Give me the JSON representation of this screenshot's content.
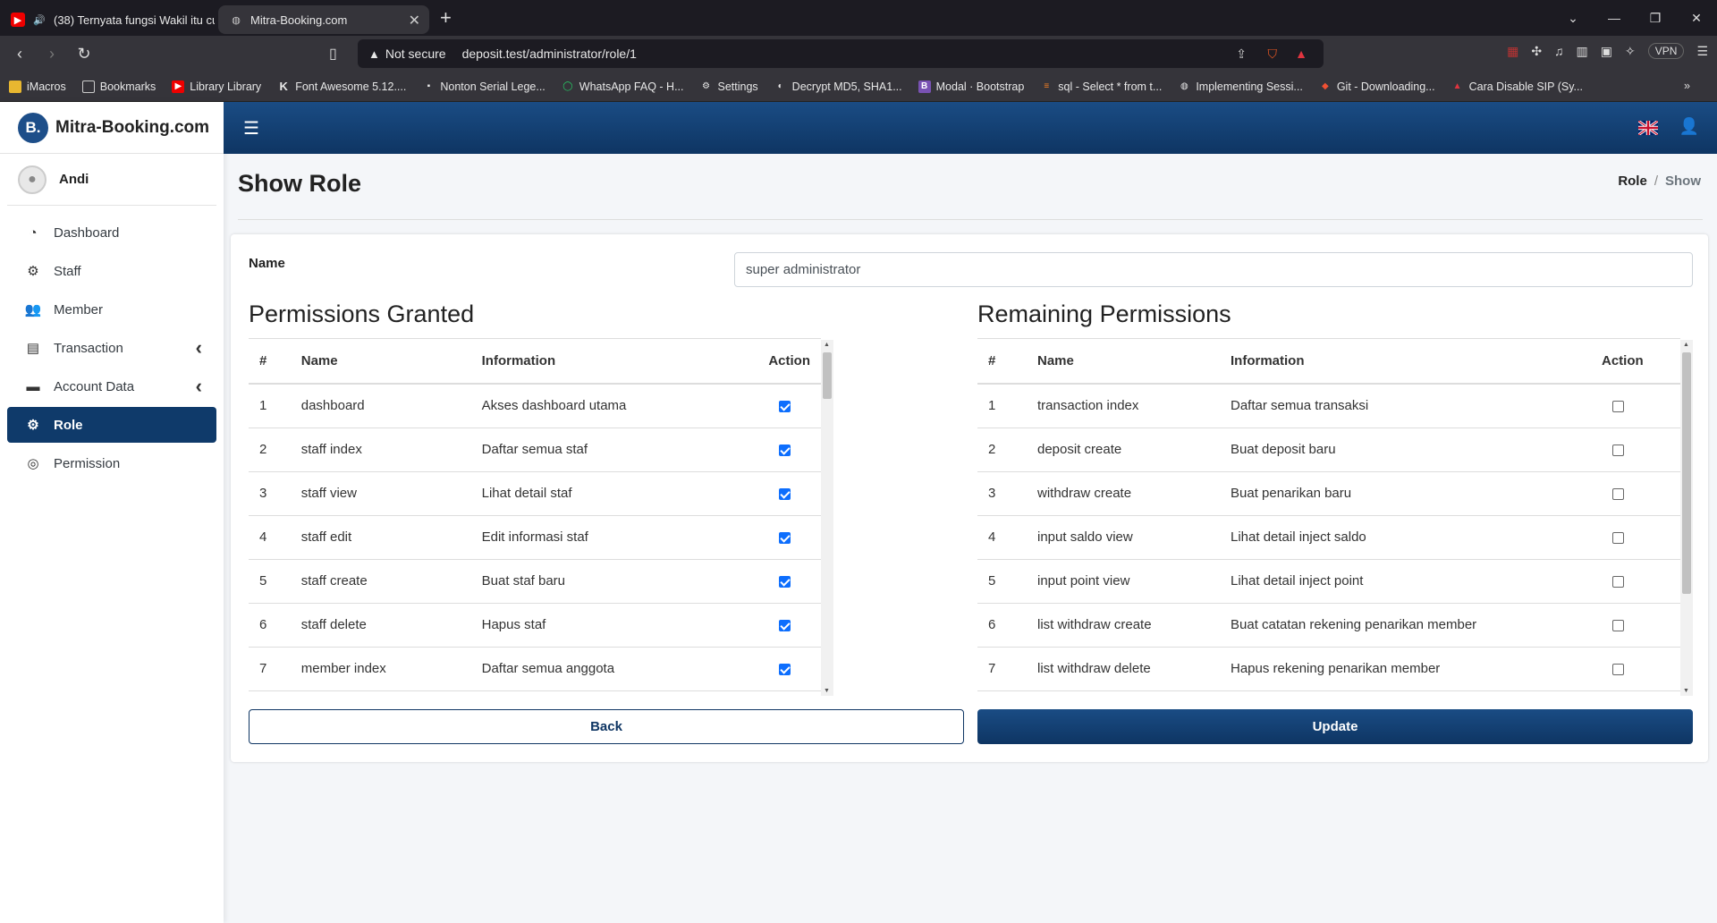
{
  "browser": {
    "tabs": [
      {
        "title": "(38) Ternyata fungsi Wakil itu cu",
        "active": false
      },
      {
        "title": "Mitra-Booking.com",
        "active": true
      }
    ],
    "security_label": "Not secure",
    "url": "deposit.test/administrator/role/1",
    "vpn_label": "VPN",
    "bookmarks": [
      "iMacros",
      "Bookmarks",
      "Library Library",
      "Font Awesome 5.12....",
      "Nonton Serial Lege...",
      "WhatsApp FAQ - H...",
      "Settings",
      "Decrypt MD5, SHA1...",
      "Modal · Bootstrap",
      "sql - Select * from t...",
      "Implementing Sessi...",
      "Git - Downloading...",
      "Cara Disable SIP (Sy..."
    ]
  },
  "app": {
    "brand_logo": "B.",
    "brand_name": "Mitra-Booking.com",
    "user_name": "Andi",
    "nav": [
      {
        "label": "Dashboard",
        "icon": "tachometer-icon",
        "glyph": "◔",
        "active": false,
        "chevron": false
      },
      {
        "label": "Staff",
        "icon": "users-cog-icon",
        "glyph": "⚙",
        "active": false,
        "chevron": false
      },
      {
        "label": "Member",
        "icon": "users-icon",
        "glyph": "👥",
        "active": false,
        "chevron": false
      },
      {
        "label": "Transaction",
        "icon": "file-invoice-dollar-icon",
        "glyph": "▤",
        "active": false,
        "chevron": true
      },
      {
        "label": "Account Data",
        "icon": "wallet-icon",
        "glyph": "▬",
        "active": false,
        "chevron": true
      },
      {
        "label": "Role",
        "icon": "user-cog-icon",
        "glyph": "⚙",
        "active": true,
        "chevron": false
      },
      {
        "label": "Permission",
        "icon": "fingerprint-icon",
        "glyph": "◎",
        "active": false,
        "chevron": false
      }
    ],
    "page_title": "Show Role",
    "breadcrumb": {
      "parent": "Role",
      "current": "Show"
    },
    "form": {
      "name_label": "Name",
      "name_value": "super administrator"
    },
    "granted": {
      "title": "Permissions Granted",
      "headers": [
        "#",
        "Name",
        "Information",
        "Action"
      ],
      "rows": [
        {
          "no": "1",
          "name": "dashboard",
          "info": "Akses dashboard utama",
          "checked": true
        },
        {
          "no": "2",
          "name": "staff index",
          "info": "Daftar semua staf",
          "checked": true
        },
        {
          "no": "3",
          "name": "staff view",
          "info": "Lihat detail staf",
          "checked": true
        },
        {
          "no": "4",
          "name": "staff edit",
          "info": "Edit informasi staf",
          "checked": true
        },
        {
          "no": "5",
          "name": "staff create",
          "info": "Buat staf baru",
          "checked": true
        },
        {
          "no": "6",
          "name": "staff delete",
          "info": "Hapus staf",
          "checked": true
        },
        {
          "no": "7",
          "name": "member index",
          "info": "Daftar semua anggota",
          "checked": true
        }
      ]
    },
    "remaining": {
      "title": "Remaining Permissions",
      "headers": [
        "#",
        "Name",
        "Information",
        "Action"
      ],
      "rows": [
        {
          "no": "1",
          "name": "transaction index",
          "info": "Daftar semua transaksi",
          "checked": false
        },
        {
          "no": "2",
          "name": "deposit create",
          "info": "Buat deposit baru",
          "checked": false
        },
        {
          "no": "3",
          "name": "withdraw create",
          "info": "Buat penarikan baru",
          "checked": false
        },
        {
          "no": "4",
          "name": "input saldo view",
          "info": "Lihat detail inject saldo",
          "checked": false
        },
        {
          "no": "5",
          "name": "input point view",
          "info": "Lihat detail inject point",
          "checked": false
        },
        {
          "no": "6",
          "name": "list withdraw create",
          "info": "Buat catatan rekening penarikan member",
          "checked": false
        },
        {
          "no": "7",
          "name": "list withdraw delete",
          "info": "Hapus rekening penarikan member",
          "checked": false
        }
      ]
    },
    "buttons": {
      "back": "Back",
      "update": "Update"
    },
    "colors": {
      "primary": "#0e3563",
      "checkbox": "#0d6efd"
    }
  }
}
